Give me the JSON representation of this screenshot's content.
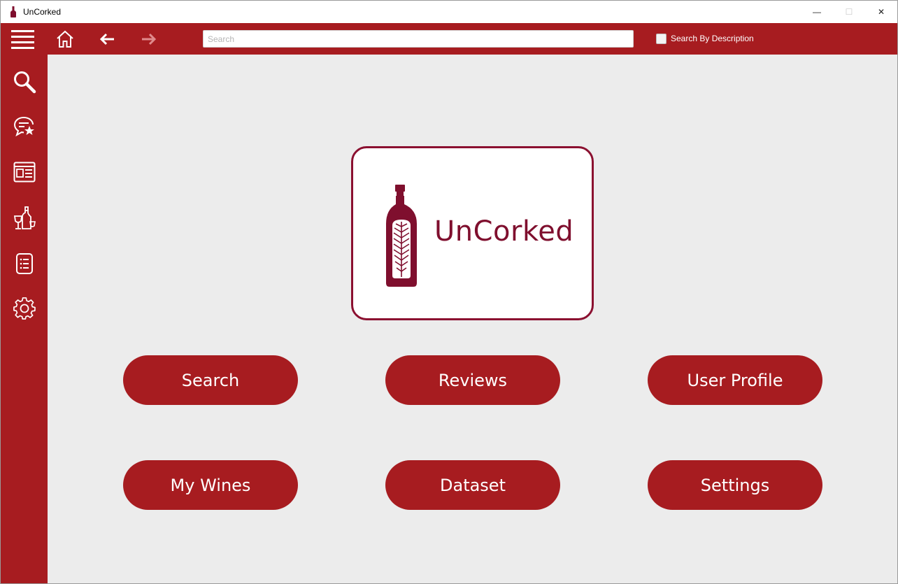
{
  "window": {
    "title": "UnCorked",
    "controls": {
      "minimize": "—",
      "maximize": "☐",
      "close": "✕"
    }
  },
  "toolbar": {
    "search_placeholder": "Search",
    "search_value": "",
    "search_by_description_label": "Search By Description",
    "search_by_description_checked": false,
    "icons": [
      "menu-icon",
      "home-icon",
      "back-arrow-icon",
      "forward-arrow-icon"
    ]
  },
  "sidebar": {
    "items": [
      {
        "name": "search",
        "icon": "magnifier-icon"
      },
      {
        "name": "reviews",
        "icon": "review-chat-star-icon"
      },
      {
        "name": "user-profile",
        "icon": "profile-card-icon"
      },
      {
        "name": "my-wines",
        "icon": "wine-bottle-glass-icon"
      },
      {
        "name": "dataset",
        "icon": "list-document-icon"
      },
      {
        "name": "settings",
        "icon": "gear-icon"
      }
    ]
  },
  "logo": {
    "text": "UnCorked",
    "icon": "wine-bottle-fern-icon"
  },
  "main": {
    "buttons": [
      {
        "label": "Search"
      },
      {
        "label": "Reviews"
      },
      {
        "label": "User Profile"
      },
      {
        "label": "My Wines"
      },
      {
        "label": "Dataset"
      },
      {
        "label": "Settings"
      }
    ]
  },
  "colors": {
    "accent": "#a71c20",
    "logo_maroon": "#7f0f2e",
    "background": "#ececec"
  }
}
